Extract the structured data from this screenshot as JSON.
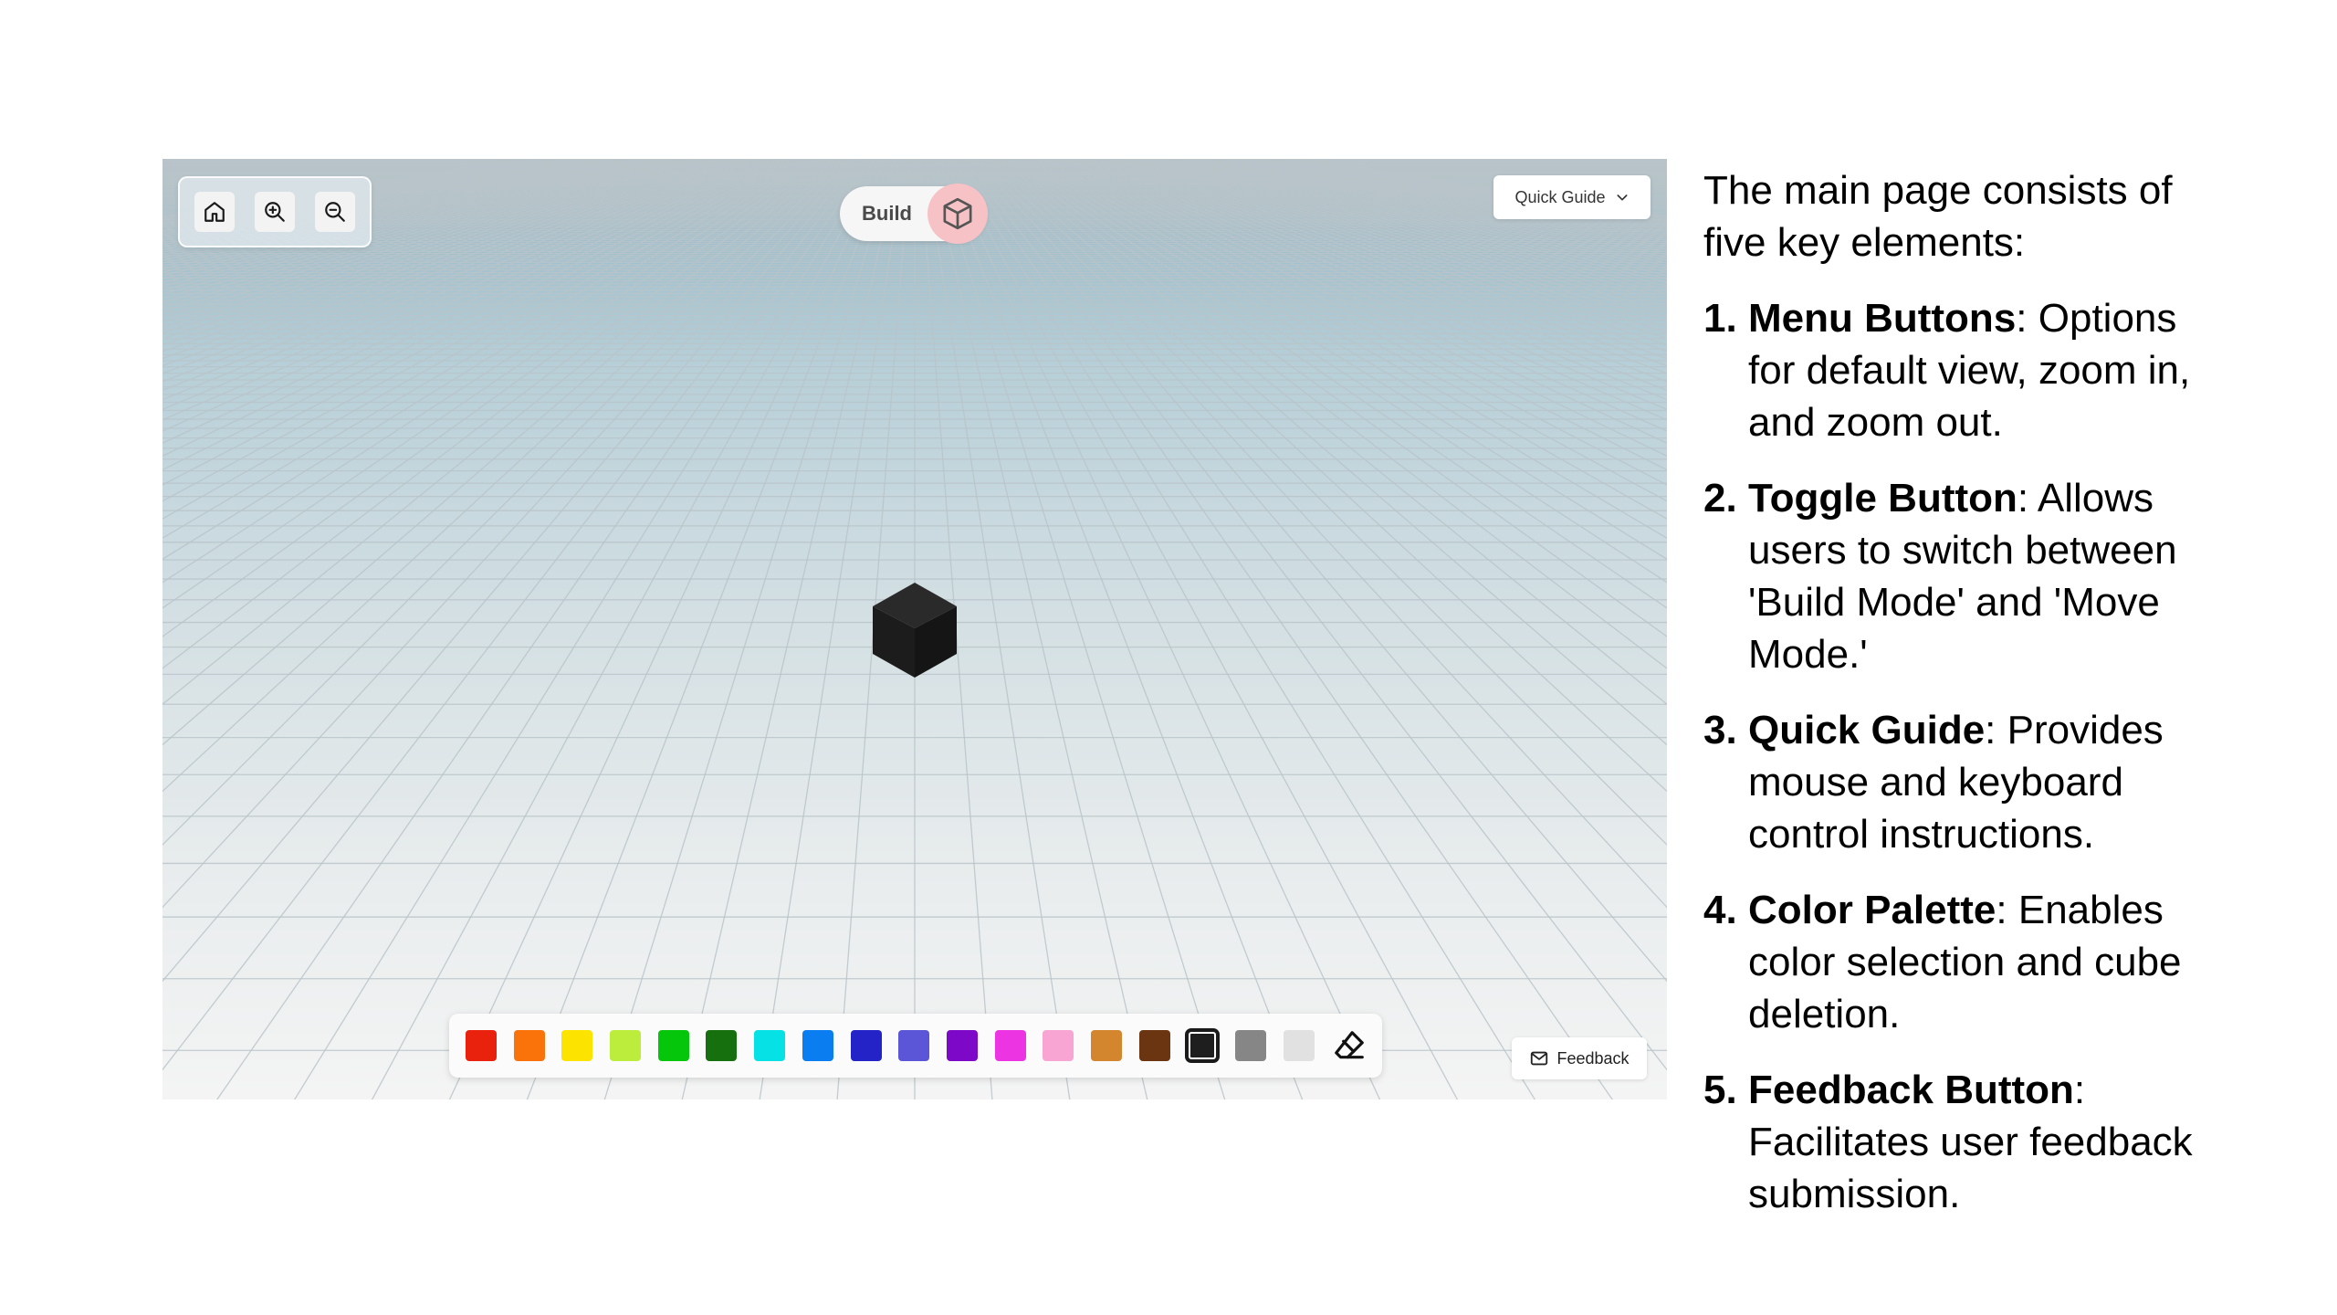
{
  "viewport": {
    "menu": {
      "home_icon": "home-icon",
      "zoom_in_icon": "zoom-in-icon",
      "zoom_out_icon": "zoom-out-icon"
    },
    "toggle": {
      "label": "Build",
      "icon": "cube-icon"
    },
    "quick_guide": {
      "label": "Quick Guide",
      "icon": "chevron-down-icon"
    },
    "palette": {
      "colors": [
        "#e8220c",
        "#fa720a",
        "#fde400",
        "#bded3c",
        "#05c60b",
        "#16700d",
        "#05e1e5",
        "#0a7df0",
        "#2323c8",
        "#5b56d8",
        "#7d08c7",
        "#ec34e2",
        "#f8a5d3",
        "#d3862d",
        "#6b3511",
        "#1e1e1e",
        "#868686",
        "#e1e1e1"
      ],
      "selected_index": 15,
      "eraser_icon": "eraser-icon"
    },
    "feedback": {
      "label": "Feedback",
      "icon": "mail-icon"
    }
  },
  "description": {
    "intro": "The main page consists of five key elements:",
    "items": [
      {
        "num": "1.",
        "term": "Menu Buttons",
        "text": ": Options for default view, zoom in, and zoom out."
      },
      {
        "num": "2.",
        "term": "Toggle Button",
        "text": ": Allows users to switch between 'Build Mode' and 'Move Mode.'"
      },
      {
        "num": "3.",
        "term": "Quick Guide",
        "text": ": Provides mouse and keyboard control instructions."
      },
      {
        "num": "4.",
        "term": "Color Palette",
        "text": ": Enables color selection and cube deletion."
      },
      {
        "num": "5.",
        "term": "Feedback Button",
        "text": ": Facilitates user feedback submission."
      }
    ]
  }
}
